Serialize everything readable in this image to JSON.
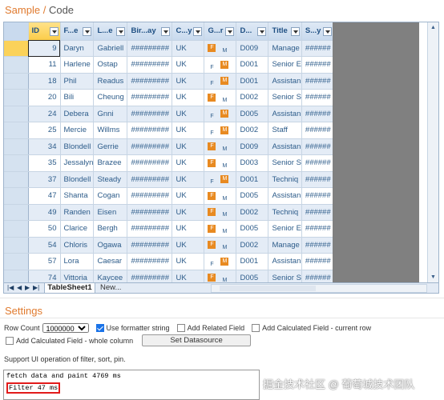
{
  "header": {
    "sample": "Sample",
    "sep": "/",
    "code": "Code"
  },
  "columns": [
    "ID",
    "F...e",
    "L...e",
    "Bir...ay",
    "C...y",
    "G...r",
    "D...",
    "Title",
    "S...y"
  ],
  "rows": [
    {
      "id": "9",
      "first": "Daryn",
      "last": "Gabriell",
      "birth": "#########",
      "country": "UK",
      "gender": "F",
      "dept": "D009",
      "title": "Manage",
      "salary": "######"
    },
    {
      "id": "11",
      "first": "Harlene",
      "last": "Ostap",
      "birth": "#########",
      "country": "UK",
      "gender": "M",
      "dept": "D001",
      "title": "Senior E",
      "salary": "######"
    },
    {
      "id": "18",
      "first": "Phil",
      "last": "Readus",
      "birth": "#########",
      "country": "UK",
      "gender": "M",
      "dept": "D001",
      "title": "Assistan",
      "salary": "######"
    },
    {
      "id": "20",
      "first": "Bili",
      "last": "Cheung",
      "birth": "#########",
      "country": "UK",
      "gender": "F",
      "dept": "D002",
      "title": "Senior S",
      "salary": "######"
    },
    {
      "id": "24",
      "first": "Debera",
      "last": "Gnni",
      "birth": "#########",
      "country": "UK",
      "gender": "M",
      "dept": "D005",
      "title": "Assistan",
      "salary": "######"
    },
    {
      "id": "25",
      "first": "Mercie",
      "last": "Willms",
      "birth": "#########",
      "country": "UK",
      "gender": "M",
      "dept": "D002",
      "title": "Staff",
      "salary": "######"
    },
    {
      "id": "34",
      "first": "Blondell",
      "last": "Gerrie",
      "birth": "#########",
      "country": "UK",
      "gender": "F",
      "dept": "D009",
      "title": "Assistan",
      "salary": "######"
    },
    {
      "id": "35",
      "first": "Jessalyn",
      "last": "Brazee",
      "birth": "#########",
      "country": "UK",
      "gender": "F",
      "dept": "D003",
      "title": "Senior S",
      "salary": "######"
    },
    {
      "id": "37",
      "first": "Blondell",
      "last": "Steady",
      "birth": "#########",
      "country": "UK",
      "gender": "M",
      "dept": "D001",
      "title": "Techniq",
      "salary": "######"
    },
    {
      "id": "47",
      "first": "Shanta",
      "last": "Cogan",
      "birth": "#########",
      "country": "UK",
      "gender": "F",
      "dept": "D005",
      "title": "Assistan",
      "salary": "######"
    },
    {
      "id": "49",
      "first": "Randen",
      "last": "Eisen",
      "birth": "#########",
      "country": "UK",
      "gender": "F",
      "dept": "D002",
      "title": "Techniq",
      "salary": "######"
    },
    {
      "id": "50",
      "first": "Clarice",
      "last": "Bergh",
      "birth": "#########",
      "country": "UK",
      "gender": "F",
      "dept": "D005",
      "title": "Senior E",
      "salary": "######"
    },
    {
      "id": "54",
      "first": "Chloris",
      "last": "Ogawa",
      "birth": "#########",
      "country": "UK",
      "gender": "F",
      "dept": "D002",
      "title": "Manage",
      "salary": "######"
    },
    {
      "id": "57",
      "first": "Lora",
      "last": "Caesar",
      "birth": "#########",
      "country": "UK",
      "gender": "M",
      "dept": "D001",
      "title": "Assistan",
      "salary": "######"
    },
    {
      "id": "74",
      "first": "Vittoria",
      "last": "Kaycee",
      "birth": "#########",
      "country": "UK",
      "gender": "F",
      "dept": "D005",
      "title": "Senior S",
      "salary": "######"
    }
  ],
  "sheet": {
    "tab": "TableSheet1",
    "new": "New..."
  },
  "settings": {
    "title": "Settings",
    "row_count_label": "Row Count",
    "row_count_value": "1000000",
    "use_formatter": "Use formatter string",
    "add_related": "Add Related Field",
    "add_calc_current": "Add Calculated Field - current row",
    "add_calc_whole": "Add Calculated Field - whole column",
    "set_datasource": "Set Datasource",
    "support": "Support UI operation of filter, sort, pin."
  },
  "log": {
    "line1": "fetch data and paint 4769 ms",
    "line2": "Filter 47 ms"
  },
  "watermark": "掘金技术社区 @ 葡萄城技术团队",
  "colors": {
    "accent": "#e07a2e",
    "gender_badge": "#e88a21",
    "highlight": "#e21b1b"
  }
}
